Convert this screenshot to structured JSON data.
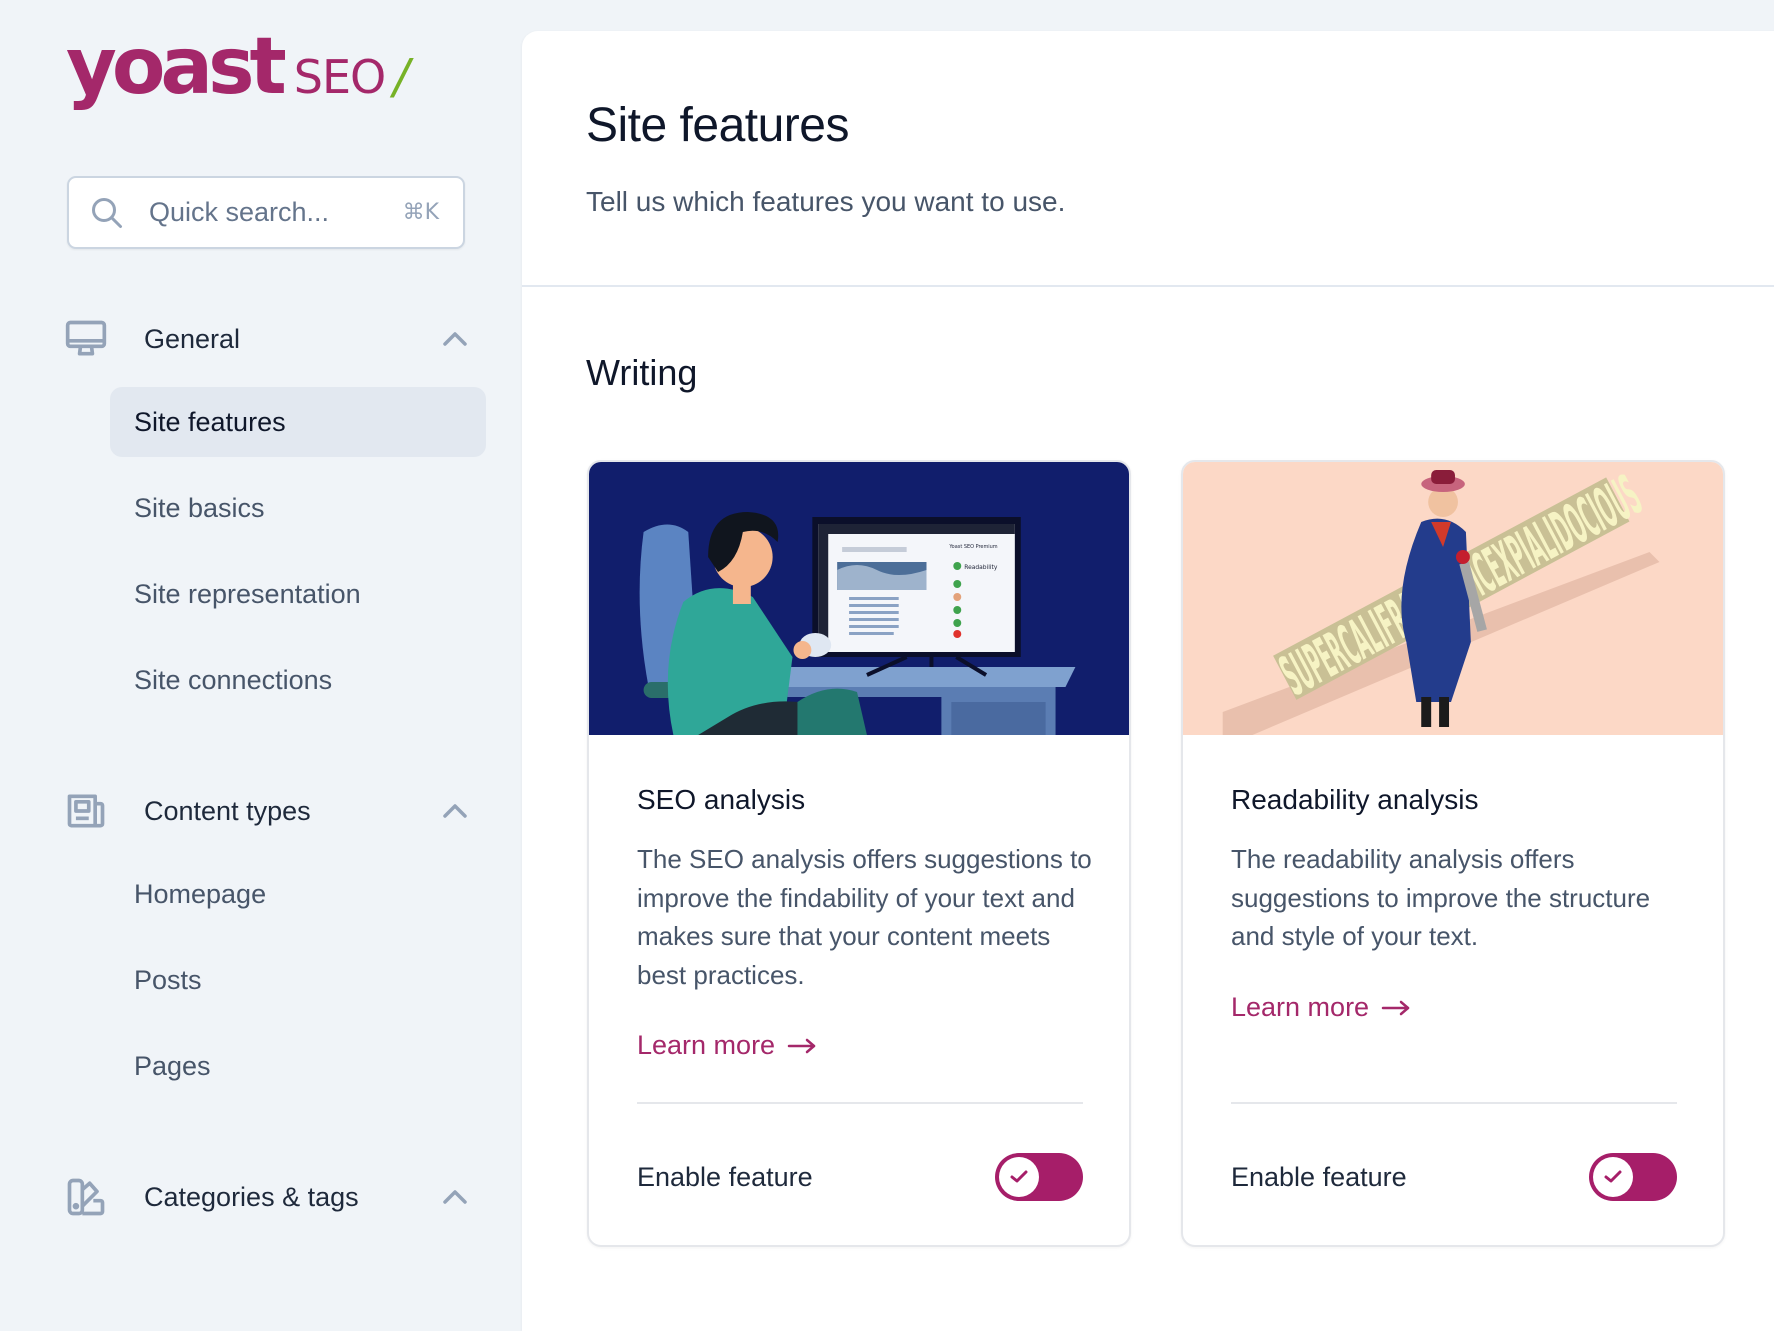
{
  "brand": {
    "logo_word": "yoast",
    "logo_product": "SEO",
    "logo_slash": "/",
    "primary_color": "#a4286a",
    "accent_color": "#77b227"
  },
  "search": {
    "placeholder": "Quick search...",
    "shortcut": "⌘K",
    "icon": "search-icon"
  },
  "sidebar": {
    "groups": [
      {
        "label": "General",
        "icon": "desktop-icon",
        "expanded": true,
        "items": [
          {
            "label": "Site features",
            "active": true
          },
          {
            "label": "Site basics",
            "active": false
          },
          {
            "label": "Site representation",
            "active": false
          },
          {
            "label": "Site connections",
            "active": false
          }
        ]
      },
      {
        "label": "Content types",
        "icon": "newspaper-icon",
        "expanded": true,
        "items": [
          {
            "label": "Homepage",
            "active": false
          },
          {
            "label": "Posts",
            "active": false
          },
          {
            "label": "Pages",
            "active": false
          }
        ]
      },
      {
        "label": "Categories & tags",
        "icon": "swatch-icon",
        "expanded": true,
        "items": []
      }
    ]
  },
  "main": {
    "title": "Site features",
    "subtitle": "Tell us which features you want to use.",
    "sections": [
      {
        "title": "Writing",
        "cards": [
          {
            "title": "SEO analysis",
            "illustration": "woman-at-computer-illustration",
            "description": "The SEO analysis offers suggestions to improve the findability of your text and makes sure that your content meets best practices.",
            "link_label": "Learn more",
            "toggle_label": "Enable feature",
            "enabled": true
          },
          {
            "title": "Readability analysis",
            "illustration": "woman-sawing-long-word-illustration",
            "illustration_text": "SUPERCALIFRAGILISTICEXPIALIDOCIOUS",
            "description": "The readability analysis offers suggestions to improve the structure and style of your text.",
            "link_label": "Learn more",
            "toggle_label": "Enable feature",
            "enabled": true
          }
        ]
      }
    ]
  }
}
